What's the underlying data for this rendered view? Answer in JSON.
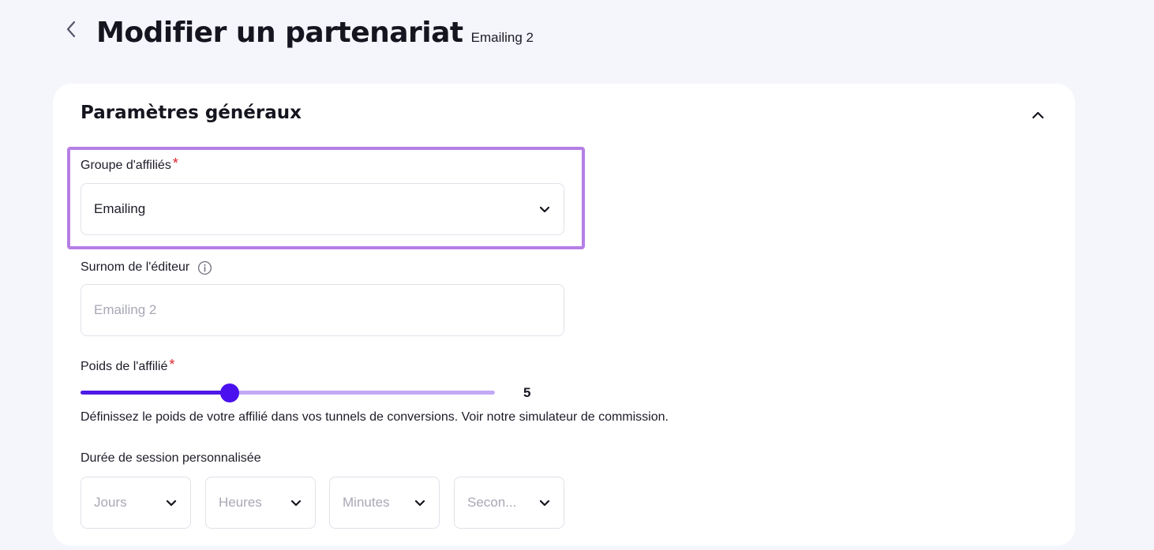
{
  "header": {
    "title": "Modifier un partenariat",
    "subtitle": "Emailing 2"
  },
  "section": {
    "title": "Paramètres généraux"
  },
  "affiliate_group": {
    "label": "Groupe d'affiliés",
    "required_mark": "*",
    "value": "Emailing"
  },
  "publisher_nickname": {
    "label": "Surnom de l'éditeur",
    "placeholder": "Emailing 2"
  },
  "affiliate_weight": {
    "label": "Poids de l'affilié",
    "required_mark": "*",
    "value": "5",
    "fill_fraction": 0.36,
    "help_text": "Définissez le poids de votre affilié dans vos tunnels de conversions. Voir notre simulateur de commission."
  },
  "session_duration": {
    "label": "Durée de session personnalisée",
    "fields": [
      {
        "placeholder": "Jours"
      },
      {
        "placeholder": "Heures"
      },
      {
        "placeholder": "Minutes"
      },
      {
        "placeholder": "Secon..."
      }
    ]
  },
  "colors": {
    "accent": "#4a10ee",
    "highlight": "#b57fe6",
    "required": "#e0252f"
  }
}
